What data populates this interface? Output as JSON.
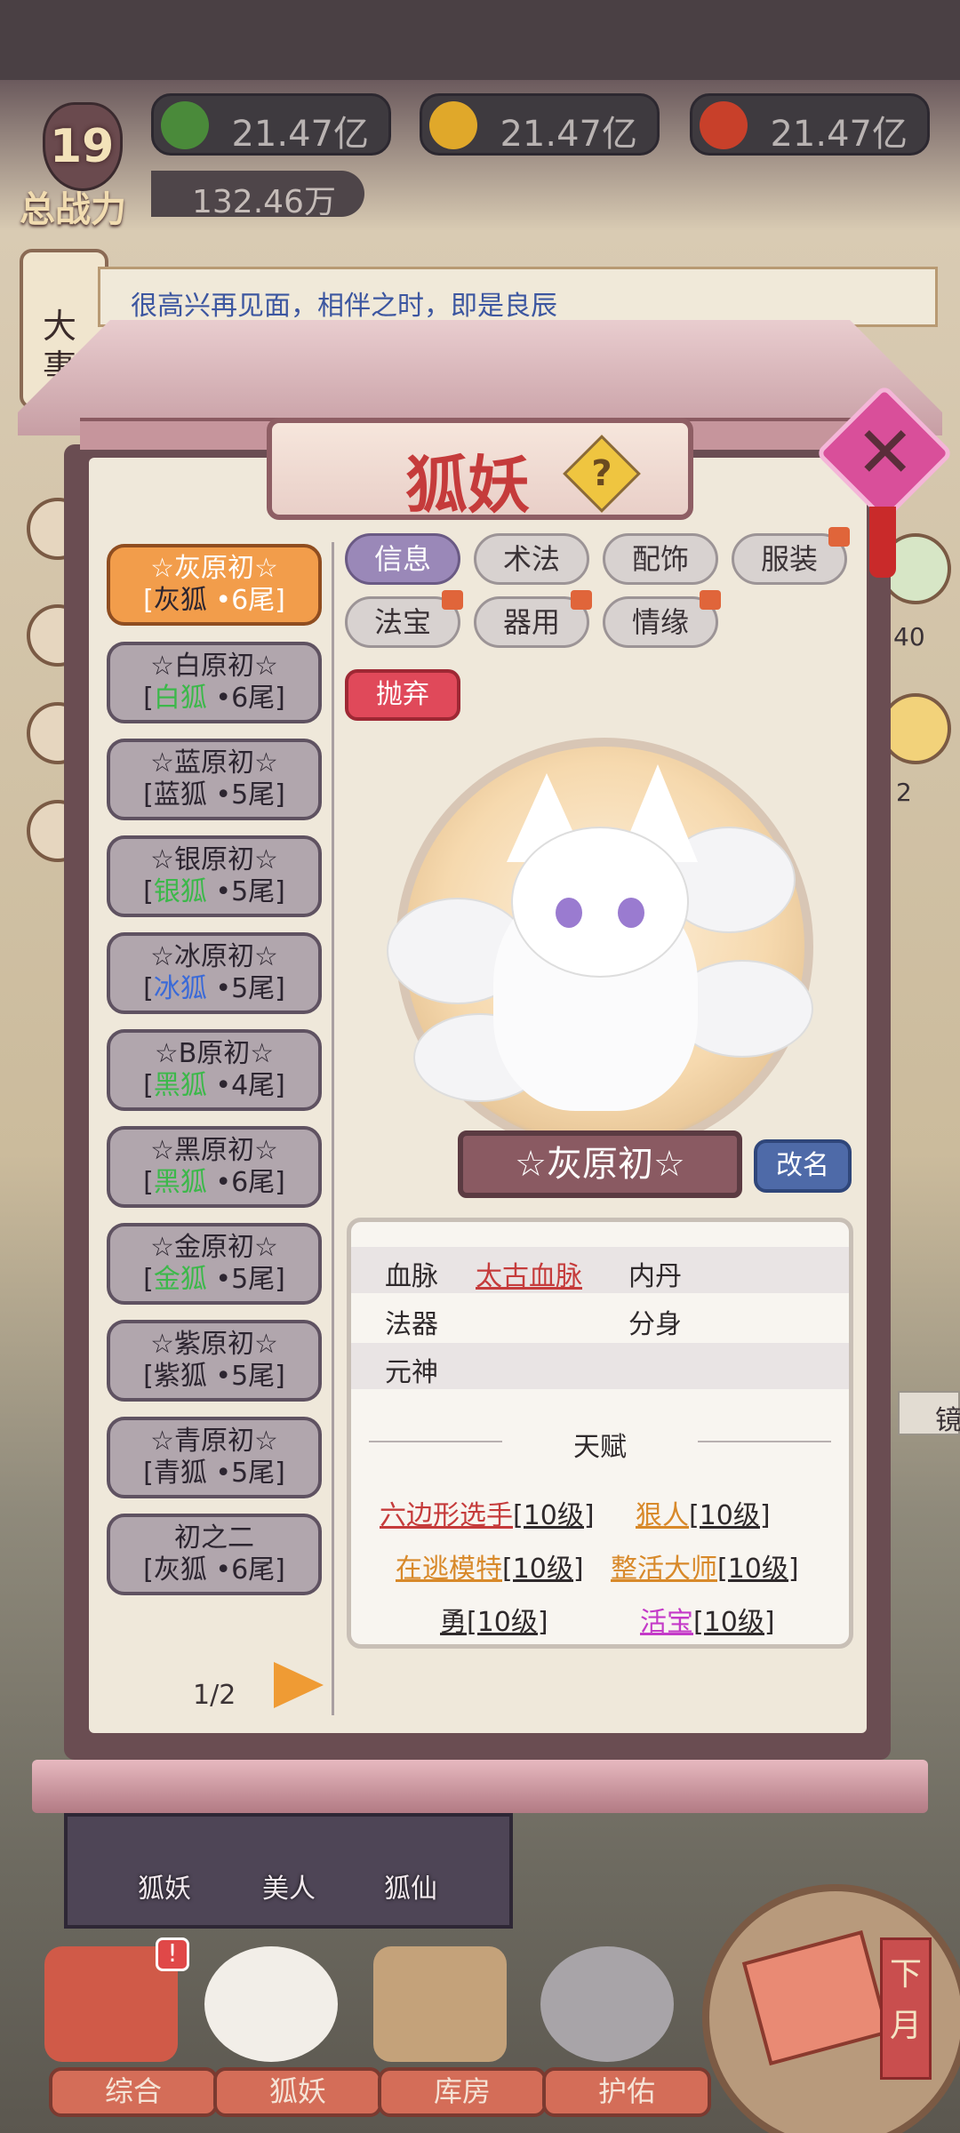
{
  "resources": [
    {
      "icon": "green-leaf-icon",
      "value": "21.47亿",
      "color": "#4a8a3a"
    },
    {
      "icon": "gold-bag-icon",
      "value": "21.47亿",
      "color": "#e0a82a"
    },
    {
      "icon": "red-fruit-icon",
      "value": "21.47亿",
      "color": "#c8402a"
    }
  ],
  "player": {
    "level": "19",
    "power_label": "总战力",
    "power": "132.46万"
  },
  "side_tab": {
    "label": "大事"
  },
  "message": "很高兴再见面，相伴之时，即是良辰",
  "panel": {
    "title": "狐妖",
    "help": "?",
    "close": "✕",
    "tabs": [
      {
        "label": "信息",
        "active": true,
        "dot": false
      },
      {
        "label": "术法",
        "active": false,
        "dot": false
      },
      {
        "label": "配饰",
        "active": false,
        "dot": false
      },
      {
        "label": "服装",
        "active": false,
        "dot": true
      },
      {
        "label": "法宝",
        "active": false,
        "dot": true
      },
      {
        "label": "器用",
        "active": false,
        "dot": true
      },
      {
        "label": "情缘",
        "active": false,
        "dot": true
      }
    ],
    "discard_label": "抛弃",
    "fox_name": "☆灰原初☆",
    "rename_label": "改名",
    "list": [
      {
        "name": "☆灰原初☆",
        "type": "灰狐",
        "tails": "•6尾",
        "type_color": "#2c2530",
        "selected": true
      },
      {
        "name": "☆白原初☆",
        "type": "白狐",
        "tails": "•6尾",
        "type_color": "#3cb84a",
        "selected": false
      },
      {
        "name": "☆蓝原初☆",
        "type": "蓝狐",
        "tails": "•5尾",
        "type_color": "#2c2530",
        "selected": false
      },
      {
        "name": "☆银原初☆",
        "type": "银狐",
        "tails": "•5尾",
        "type_color": "#3cb84a",
        "selected": false
      },
      {
        "name": "☆冰原初☆",
        "type": "冰狐",
        "tails": "•5尾",
        "type_color": "#3a6ad8",
        "selected": false
      },
      {
        "name": "☆B原初☆",
        "type": "黑狐",
        "tails": "•4尾",
        "type_color": "#3cb84a",
        "selected": false
      },
      {
        "name": "☆黑原初☆",
        "type": "黑狐",
        "tails": "•6尾",
        "type_color": "#3cb84a",
        "selected": false
      },
      {
        "name": "☆金原初☆",
        "type": "金狐",
        "tails": "•5尾",
        "type_color": "#3cb84a",
        "selected": false
      },
      {
        "name": "☆紫原初☆",
        "type": "紫狐",
        "tails": "•5尾",
        "type_color": "#2c2530",
        "selected": false
      },
      {
        "name": "☆青原初☆",
        "type": "青狐",
        "tails": "•5尾",
        "type_color": "#2c2530",
        "selected": false
      },
      {
        "name": "初之二",
        "type": "灰狐",
        "tails": "•6尾",
        "type_color": "#2c2530",
        "selected": false
      }
    ],
    "page": "1/2",
    "info": {
      "bloodline_label": "血脉",
      "bloodline_value": "太古血脉",
      "neidan_label": "内丹",
      "faqi_label": "法器",
      "fenshen_label": "分身",
      "yuanshen_label": "元神",
      "talent_header": "天赋",
      "talents": [
        {
          "name": "六边形选手",
          "level": "[10级]",
          "color": "#c53b3b"
        },
        {
          "name": "狠人",
          "level": "[10级]",
          "color": "#d8892a"
        },
        {
          "name": "在逃模特",
          "level": "[10级]",
          "color": "#d8892a"
        },
        {
          "name": "整活大师",
          "level": "[10级]",
          "color": "#d8892a"
        },
        {
          "name": "勇",
          "level": "[10级]",
          "color": "#2f2a2c"
        },
        {
          "name": "活宝",
          "level": "[10级]",
          "color": "#c43ac8"
        }
      ]
    }
  },
  "subtabs": [
    "狐妖",
    "美人",
    "狐仙"
  ],
  "nav": [
    "综合",
    "狐妖",
    "库房",
    "护佑"
  ],
  "nav_badge": "!",
  "next_month": "下月",
  "side_peek": {
    "count1": "40",
    "count2": "2",
    "label": "镜"
  }
}
